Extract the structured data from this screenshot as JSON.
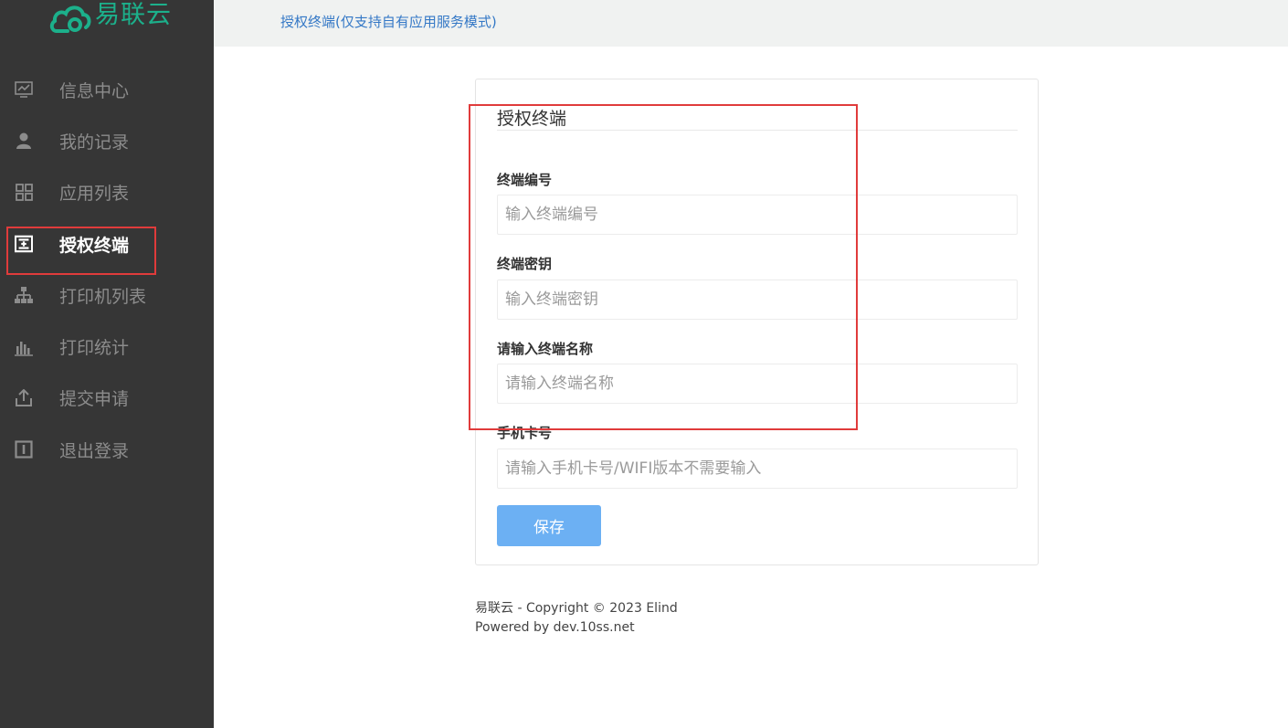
{
  "app": {
    "logo_text": "易联云",
    "brand_color": "#1cb08b"
  },
  "sidebar": {
    "items": [
      {
        "label": "信息中心",
        "icon": "monitor-chart-icon",
        "active": false
      },
      {
        "label": "我的记录",
        "icon": "user-icon",
        "active": false
      },
      {
        "label": "应用列表",
        "icon": "grid-icon",
        "active": false
      },
      {
        "label": "授权终端",
        "icon": "terminal-add-icon",
        "active": true
      },
      {
        "label": "打印机列表",
        "icon": "network-icon",
        "active": false
      },
      {
        "label": "打印统计",
        "icon": "bar-chart-icon",
        "active": false
      },
      {
        "label": "提交申请",
        "icon": "upload-icon",
        "active": false
      },
      {
        "label": "退出登录",
        "icon": "logout-icon",
        "active": false
      }
    ]
  },
  "header": {
    "breadcrumb": "授权终端(仅支持自有应用服务模式)"
  },
  "form": {
    "title": "授权终端",
    "fields": [
      {
        "label": "终端编号",
        "placeholder": "输入终端编号",
        "value": ""
      },
      {
        "label": "终端密钥",
        "placeholder": "输入终端密钥",
        "value": ""
      },
      {
        "label": "请输入终端名称",
        "placeholder": "请输入终端名称",
        "value": ""
      },
      {
        "label": "手机卡号",
        "placeholder": "请输入手机卡号/WIFI版本不需要输入",
        "value": ""
      }
    ],
    "save_label": "保存"
  },
  "footer": {
    "copyright": "易联云 - Copyright © 2023 Elind",
    "powered_by": "Powered by dev.10ss.net"
  },
  "colors": {
    "sidebar_bg": "#363636",
    "accent": "#3478c6",
    "button": "#6cb0f3",
    "highlight": "#e03b3b"
  }
}
